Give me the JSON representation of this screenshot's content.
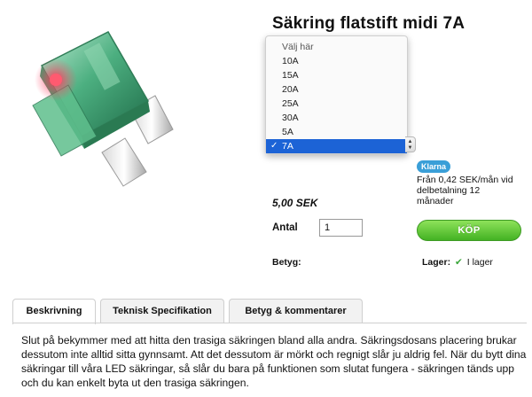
{
  "product": {
    "title": "Säkring flatstift midi 7A",
    "price": "5,00 SEK"
  },
  "variant_select": {
    "options": [
      {
        "label": "Välj här",
        "placeholder": true,
        "selected": false
      },
      {
        "label": "10A",
        "selected": false
      },
      {
        "label": "15A",
        "selected": false
      },
      {
        "label": "20A",
        "selected": false
      },
      {
        "label": "25A",
        "selected": false
      },
      {
        "label": "30A",
        "selected": false
      },
      {
        "label": "5A",
        "selected": false
      },
      {
        "label": "7A",
        "selected": true
      }
    ],
    "check_icon": "checkmark-icon"
  },
  "klarna": {
    "badge": "Klarna",
    "text": "Från 0,42 SEK/mån vid delbetalning 12 månader",
    "color": "#3a9fd8"
  },
  "quantity": {
    "label": "Antal",
    "value": "1"
  },
  "buy_button": {
    "label": "KÖP",
    "color": "#43b223"
  },
  "rating": {
    "label": "Betyg:"
  },
  "stock": {
    "label": "Lager:",
    "icon": "checkmark-icon",
    "value": "I lager"
  },
  "tabs": [
    {
      "label": "Beskrivning",
      "active": true
    },
    {
      "label": "Teknisk Specifikation",
      "active": false
    },
    {
      "label": "Betyg & kommentarer",
      "active": false
    }
  ],
  "description": "Slut på bekymmer med att hitta den trasiga säkringen bland alla andra. Säkringsdosans placering brukar dessutom inte alltid sitta gynnsamt. Att det dessutom är mörkt och regnigt slår ju aldrig fel. När du bytt dina säkringar till våra LED säkringar, så slår du bara på funktionen som slutat fungera - säkringen tänds upp och du kan enkelt byta ut den trasiga säkringen."
}
